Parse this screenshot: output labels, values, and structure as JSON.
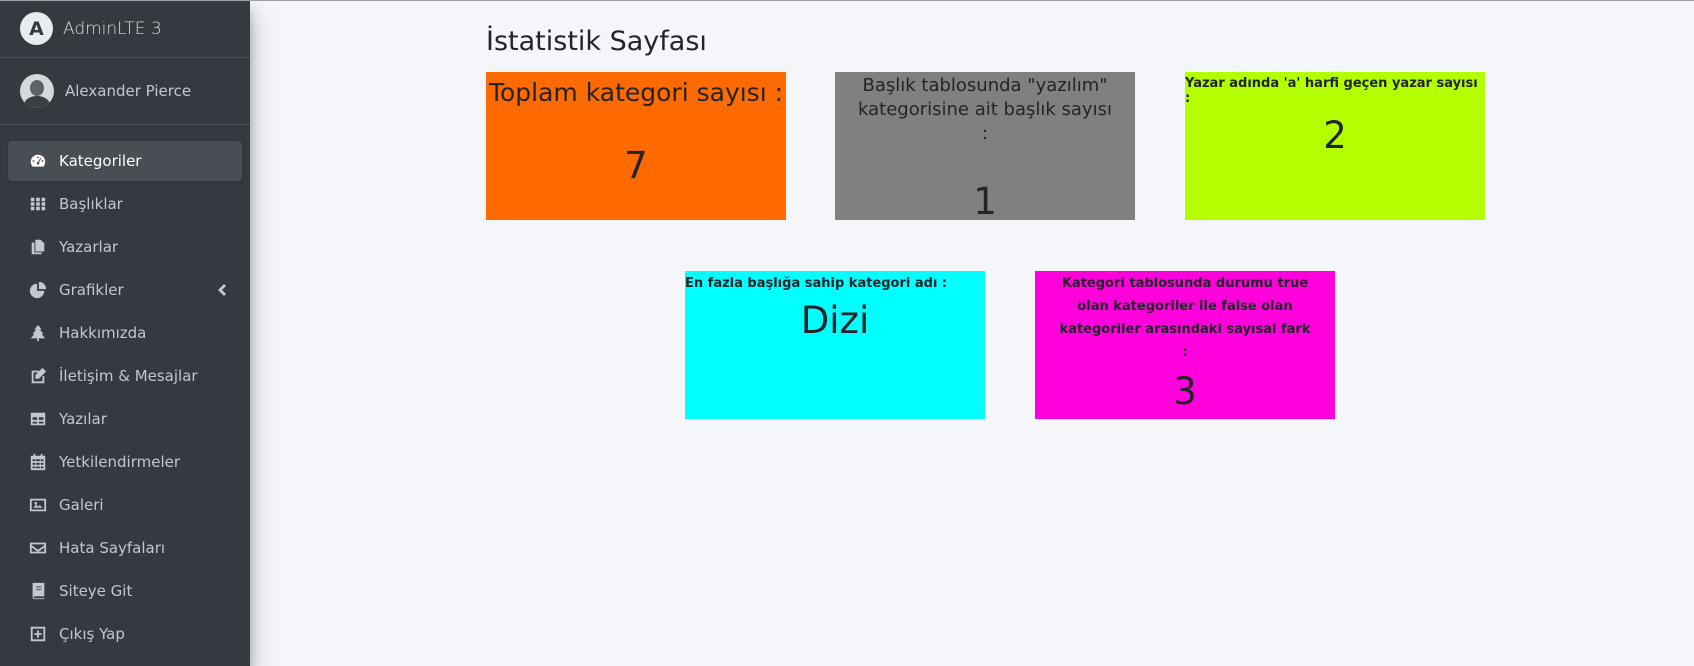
{
  "brand": {
    "name": "AdminLTE 3",
    "logo_letter": "A"
  },
  "user": {
    "name": "Alexander Pierce"
  },
  "sidebar": {
    "items": [
      {
        "label": "Kategoriler",
        "icon": "tachometer-icon",
        "active": true
      },
      {
        "label": "Başlıklar",
        "icon": "grid-icon"
      },
      {
        "label": "Yazarlar",
        "icon": "copy-icon"
      },
      {
        "label": "Grafikler",
        "icon": "pie-chart-icon",
        "has_submenu": true
      },
      {
        "label": "Hakkımızda",
        "icon": "tree-icon"
      },
      {
        "label": "İletişim & Mesajlar",
        "icon": "edit-icon"
      },
      {
        "label": "Yazılar",
        "icon": "table-icon"
      },
      {
        "label": "Yetkilendirmeler",
        "icon": "calendar-icon"
      },
      {
        "label": "Galeri",
        "icon": "image-icon"
      },
      {
        "label": "Hata Sayfaları",
        "icon": "envelope-icon"
      },
      {
        "label": "Siteye Git",
        "icon": "book-icon"
      },
      {
        "label": "Çıkış Yap",
        "icon": "plus-square-icon"
      }
    ]
  },
  "main": {
    "title": "İstatistik Sayfası",
    "cards": {
      "total_categories": {
        "label": "Toplam kategori sayısı :",
        "value": "7",
        "color": "#ff6a00"
      },
      "software_titles": {
        "label": "Başlık tablosunda \"yazılım\" kategorisine ait başlık sayısı :",
        "value": "1",
        "color": "#808080"
      },
      "authors_with_a": {
        "label": "Yazar adında 'a' harfi geçen yazar sayısı :",
        "value": "2",
        "color": "#b3ff00"
      },
      "top_category": {
        "label": "En fazla başlığa sahip kategori adı :",
        "value": "Dizi",
        "color": "#00ffff"
      },
      "status_difference": {
        "label": "Kategori tablosunda durumu true olan kategoriler ile false olan kategoriler arasındaki sayısal fark :",
        "value": "3",
        "color": "#ff00dd"
      }
    }
  }
}
